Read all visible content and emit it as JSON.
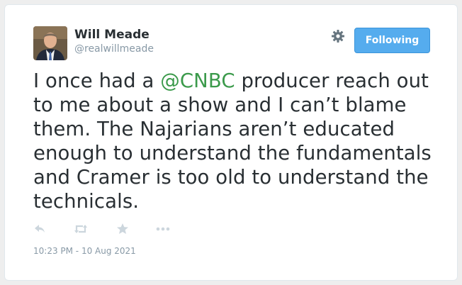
{
  "author": {
    "name": "Will Meade",
    "handle": "@realwillmeade",
    "avatar_icon": "avatar-photo"
  },
  "follow_button": {
    "label": "Following",
    "color": "#55acee"
  },
  "tweet": {
    "before_mention": "I once had a ",
    "mention": "@CNBC",
    "after_mention": " producer reach out to me about a show and I can’t blame them. The Najarians aren’t educated enough to understand the fundamentals and Cramer is too old to understand the technicals.",
    "mention_color": "#3b9a4b"
  },
  "actions": [
    "reply-icon",
    "retweet-icon",
    "like-icon",
    "more-icon"
  ],
  "timestamp": "10:23 PM - 10 Aug 2021",
  "settings_icon": "gear-icon"
}
